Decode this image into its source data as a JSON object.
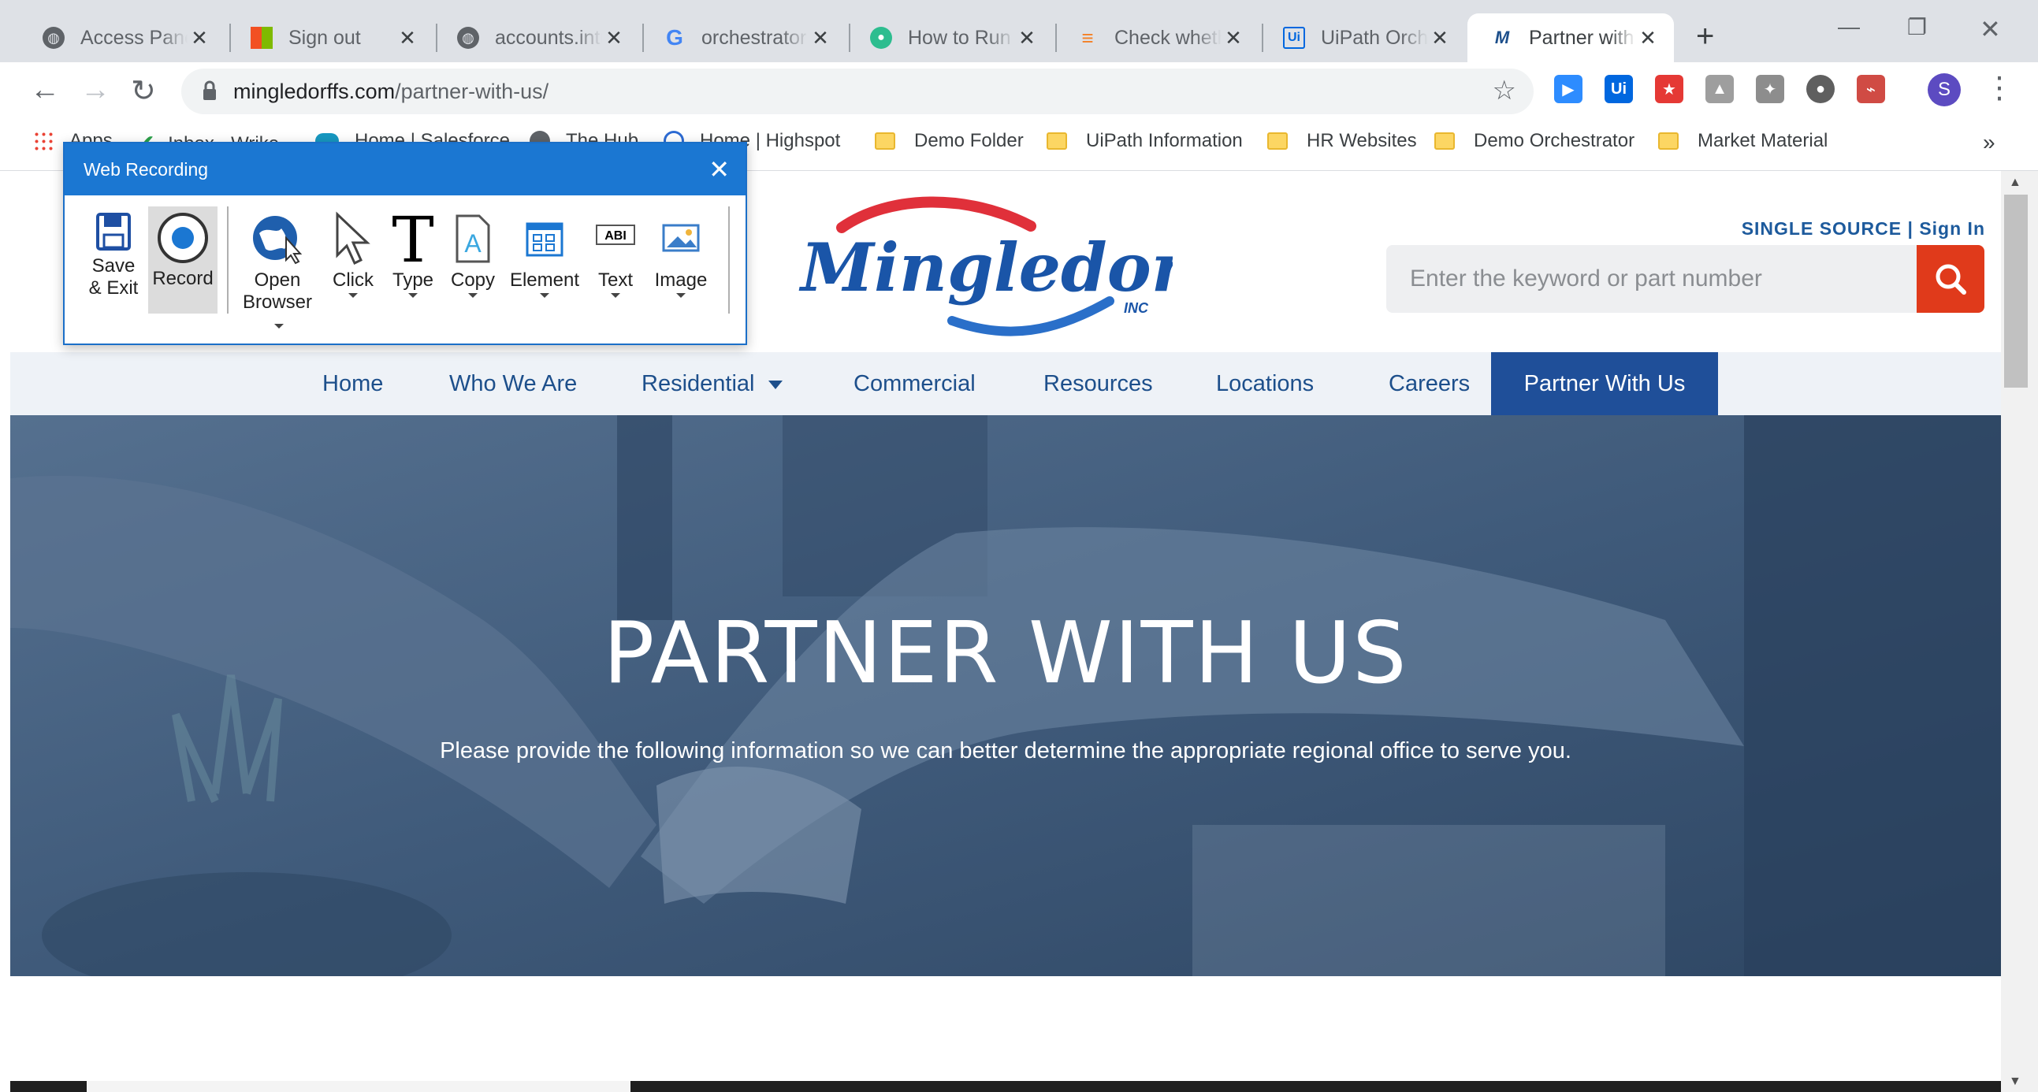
{
  "browser": {
    "tabs": [
      {
        "label": "Access Panel",
        "icon": "globe-icon"
      },
      {
        "label": "Sign out",
        "icon": "microsoft-icon"
      },
      {
        "label": "accounts.intu",
        "icon": "globe-icon"
      },
      {
        "label": "orchestrator",
        "icon": "google-icon"
      },
      {
        "label": "How to Run",
        "icon": "uipath-forum-icon"
      },
      {
        "label": "Check wheth",
        "icon": "stackoverflow-icon"
      },
      {
        "label": "UiPath Orche",
        "icon": "uipath-icon"
      },
      {
        "label": "Partner with",
        "icon": "mingledorffs-icon"
      }
    ],
    "url_domain": "mingledorffs.com",
    "url_path": "/partner-with-us/",
    "profile_initial": "S",
    "bookmarks": [
      {
        "label": "Apps",
        "icon": "apps-grid-icon"
      },
      {
        "label": "Inbox - Wrike",
        "icon": "wrike-icon"
      },
      {
        "label": "Home | Salesforce",
        "icon": "salesforce-icon"
      },
      {
        "label": "The Hub",
        "icon": "globe-icon"
      },
      {
        "label": "Home | Highspot",
        "icon": "highspot-icon"
      },
      {
        "label": "Demo Folder",
        "icon": "folder-icon"
      },
      {
        "label": "UiPath Information",
        "icon": "folder-icon"
      },
      {
        "label": "HR Websites",
        "icon": "folder-icon"
      },
      {
        "label": "Demo Orchestrator",
        "icon": "folder-icon"
      },
      {
        "label": "Market Material",
        "icon": "folder-icon"
      }
    ],
    "bookmarks_overflow": "»"
  },
  "site": {
    "logo_text": "Mingledorff's",
    "logo_inc": "INC",
    "single_source": "SINGLE SOURCE",
    "separator": "|",
    "sign_in": "Sign In",
    "search_placeholder": "Enter the keyword or part number",
    "nav": [
      "Home",
      "Who We Are",
      "Residential",
      "Commercial",
      "Resources",
      "Locations",
      "Careers",
      "Partner With Us"
    ],
    "hero_title": "PARTNER WITH US",
    "hero_subtitle": "Please provide the following information so we can better determine the appropriate regional office to serve you."
  },
  "web_recording": {
    "title": "Web Recording",
    "buttons": {
      "save_1": "Save",
      "save_2": "& Exit",
      "record": "Record",
      "open_1": "Open",
      "open_2": "Browser",
      "click": "Click",
      "type": "Type",
      "copy": "Copy",
      "element": "Element",
      "text": "Text",
      "image": "Image"
    }
  },
  "colors": {
    "brand_blue": "#1d4f8b",
    "nav_active": "#1f4f99",
    "search_button": "#e03a1b",
    "dialog_title": "#1b77d2"
  }
}
